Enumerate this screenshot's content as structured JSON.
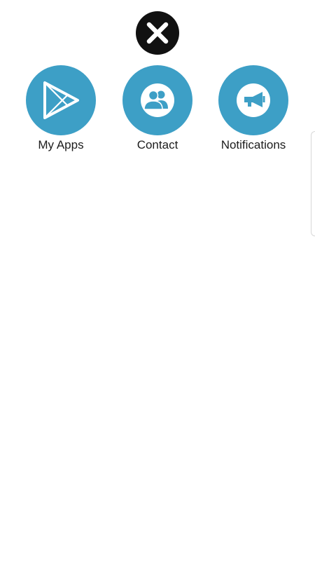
{
  "overlay": {
    "close_icon": "close-x-icon"
  },
  "menu": {
    "items": [
      {
        "label": "My Apps",
        "icon": "play-store-icon"
      },
      {
        "label": "Contact",
        "icon": "contacts-icon"
      },
      {
        "label": "Notifications",
        "icon": "megaphone-icon"
      }
    ]
  },
  "colors": {
    "accent": "#3d9fc6",
    "close_background": "#111111",
    "label_text": "#1c1c1c",
    "background": "#ffffff"
  }
}
